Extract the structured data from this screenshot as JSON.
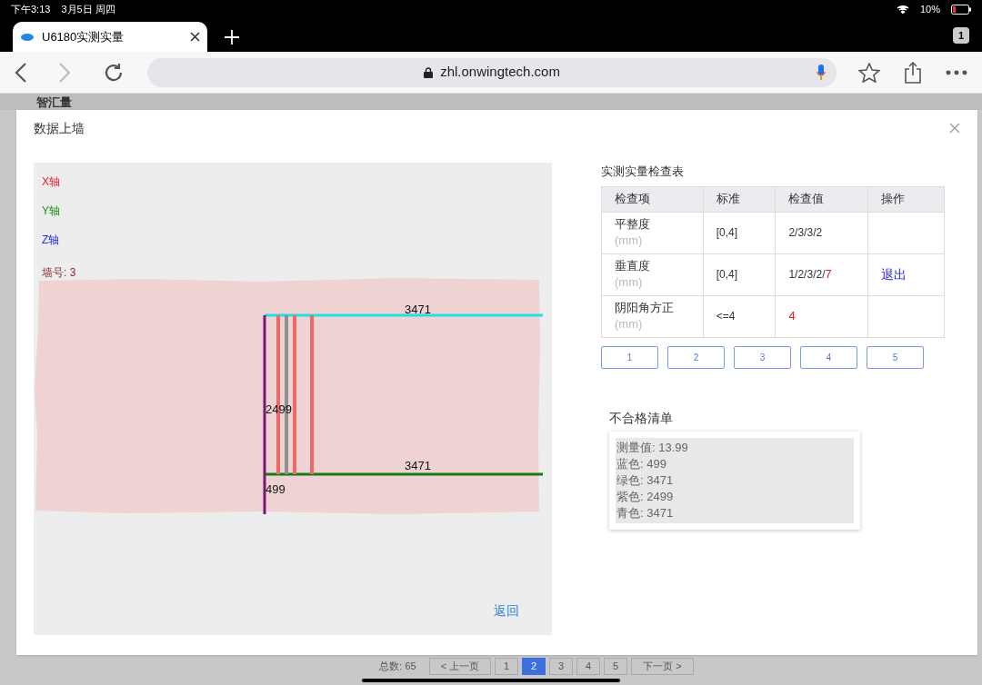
{
  "status_bar": {
    "time": "下午3:13",
    "date": "3月5日 周四",
    "battery": "10%"
  },
  "browser": {
    "tab_title": "U6180实测实量",
    "tab_count": "1",
    "url": "zhl.onwingtech.com"
  },
  "background_page": {
    "brand": "智汇量",
    "total": "总数: 65",
    "prev": "< 上一页",
    "pages": [
      {
        "label": "1",
        "selected": false
      },
      {
        "label": "2",
        "selected": true
      },
      {
        "label": "3",
        "selected": false
      },
      {
        "label": "4",
        "selected": false
      },
      {
        "label": "5",
        "selected": false
      }
    ],
    "next": "下一页 >"
  },
  "dialog": {
    "title": "数据上墙",
    "legend": [
      {
        "label": "X轴",
        "color": "#e8242f"
      },
      {
        "label": "Y轴",
        "color": "#1a8f1a"
      },
      {
        "label": "Z轴",
        "color": "#2b2bd6"
      }
    ],
    "wall_label": "墙号: 3",
    "labels": [
      {
        "text": "3471",
        "kind": "top"
      },
      {
        "text": "2499",
        "kind": "left"
      },
      {
        "text": "3471",
        "kind": "bottom"
      },
      {
        "text": "499",
        "kind": "below"
      }
    ],
    "back_link": "返回",
    "table_title": "实测实量检查表",
    "columns": [
      "检查项",
      "标准",
      "检查值",
      "操作"
    ],
    "rows": [
      {
        "item": "平整度",
        "unit": "(mm)",
        "standard": "[0,4]",
        "values": [
          {
            "text": "2/3/3/2",
            "fail": false
          }
        ],
        "action": ""
      },
      {
        "item": "垂直度",
        "unit": "(mm)",
        "standard": "[0,4]",
        "values": [
          {
            "text": "1/2/3/2/",
            "fail": false
          },
          {
            "text": "7",
            "fail": true
          }
        ],
        "action": "退出"
      },
      {
        "item": "阴阳角方正",
        "unit": "(mm)",
        "standard": "<=4",
        "values": [
          {
            "text": "4",
            "fail": true
          }
        ],
        "action": ""
      }
    ],
    "buttons": [
      "1",
      "2",
      "3",
      "4",
      "5"
    ],
    "fail_title": "不合格清单",
    "fail_lines": [
      "测量值: 13.99",
      "蓝色: 499",
      "绿色: 3471",
      "紫色: 2499",
      "青色: 3471"
    ]
  }
}
